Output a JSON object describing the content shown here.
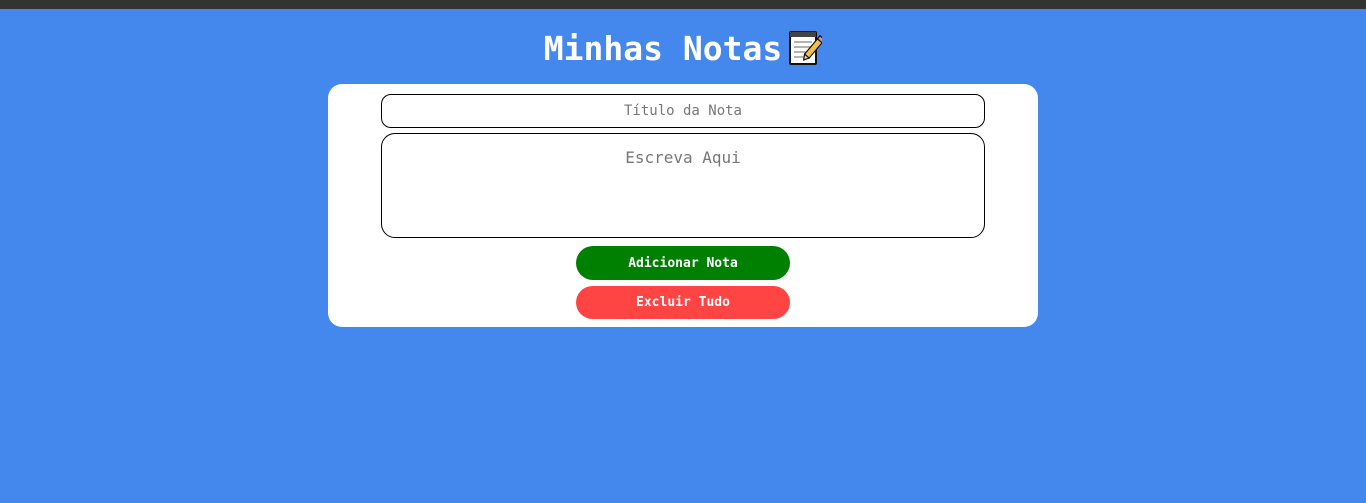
{
  "header": {
    "title": "Minhas Notas",
    "icon": "memo-icon"
  },
  "form": {
    "title_placeholder": "Título da Nota",
    "title_value": "",
    "body_placeholder": "Escreva Aqui",
    "body_value": ""
  },
  "buttons": {
    "add_label": "Adicionar Nota",
    "clear_label": "Excluir Tudo"
  },
  "colors": {
    "background": "#4488ee",
    "top_strip": "#333333",
    "card": "#ffffff",
    "add_button": "#008000",
    "clear_button": "#ff4444"
  }
}
